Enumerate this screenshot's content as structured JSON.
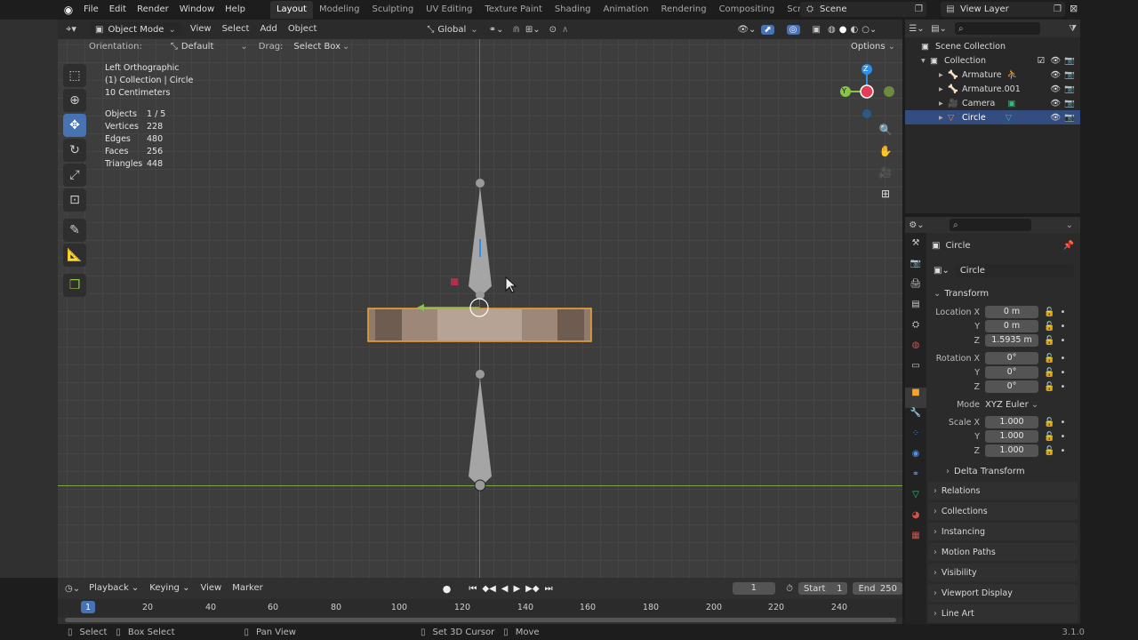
{
  "topbar": {
    "menus": [
      "File",
      "Edit",
      "Render",
      "Window",
      "Help"
    ],
    "workspaces": [
      "Layout",
      "Modeling",
      "Sculpting",
      "UV Editing",
      "Texture Paint",
      "Shading",
      "Animation",
      "Rendering",
      "Compositing",
      "Scripting"
    ],
    "active_workspace": "Layout",
    "scene": "Scene",
    "view_layer": "View Layer"
  },
  "viewport_header": {
    "mode": "Object Mode",
    "menus": [
      "View",
      "Select",
      "Add",
      "Object"
    ],
    "transform_orientation": "Global",
    "orientation_label": "Orientation:",
    "orientation_value": "Default",
    "drag_label": "Drag:",
    "drag_value": "Select Box",
    "options": "Options"
  },
  "overlay": {
    "view_name": "Left Orthographic",
    "collection_info": "(1) Collection | Circle",
    "grid_scale": "10 Centimeters",
    "stats": [
      {
        "label": "Objects",
        "value": "1 / 5"
      },
      {
        "label": "Vertices",
        "value": "228"
      },
      {
        "label": "Edges",
        "value": "480"
      },
      {
        "label": "Faces",
        "value": "256"
      },
      {
        "label": "Triangles",
        "value": "448"
      }
    ]
  },
  "gizmo": {
    "z": "Z",
    "y": "Y"
  },
  "outliner": {
    "root": "Scene Collection",
    "collection": "Collection",
    "items": [
      {
        "name": "Armature",
        "selected": false
      },
      {
        "name": "Armature.001",
        "selected": false
      },
      {
        "name": "Camera",
        "selected": false
      },
      {
        "name": "Circle",
        "selected": true
      }
    ]
  },
  "properties": {
    "object_name": "Circle",
    "name_field": "Circle",
    "transform_title": "Transform",
    "location": {
      "label": "Location X",
      "x": "0 m",
      "y": "0 m",
      "z": "1.5935 m"
    },
    "rotation": {
      "label": "Rotation X",
      "x": "0°",
      "y": "0°",
      "z": "0°"
    },
    "mode_label": "Mode",
    "mode_value": "XYZ Euler",
    "scale": {
      "label": "Scale X",
      "x": "1.000",
      "y": "1.000",
      "z": "1.000"
    },
    "axis_y": "Y",
    "axis_z": "Z",
    "delta_transform": "Delta Transform",
    "panels": [
      "Relations",
      "Collections",
      "Instancing",
      "Motion Paths",
      "Visibility",
      "Viewport Display",
      "Line Art"
    ]
  },
  "timeline": {
    "menus": [
      "Playback",
      "Keying",
      "View",
      "Marker"
    ],
    "current_frame": "1",
    "start_label": "Start",
    "start_value": "1",
    "end_label": "End",
    "end_value": "250",
    "ticks": [
      "1",
      "20",
      "40",
      "60",
      "80",
      "100",
      "120",
      "140",
      "160",
      "180",
      "200",
      "220",
      "240"
    ]
  },
  "statusbar": {
    "select": "Select",
    "box_select": "Box Select",
    "pan_view": "Pan View",
    "set_cursor": "Set 3D Cursor",
    "move": "Move",
    "version": "3.1.0"
  },
  "colors": {
    "accent": "#4772b3",
    "selection_outline": "#f2a531",
    "x_axis": "#e33d55",
    "y_axis": "#8bc34a",
    "z_axis": "#2e8fe6"
  }
}
